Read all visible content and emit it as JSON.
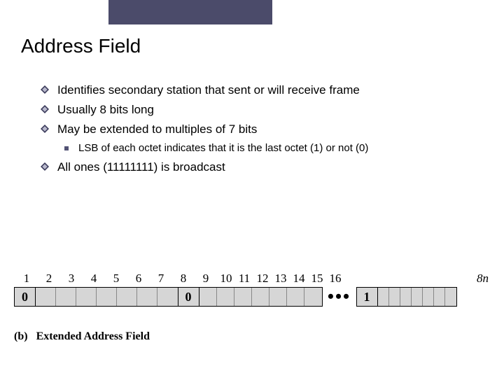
{
  "title": "Address Field",
  "bullets": {
    "b1": "Identifies secondary station that sent or will receive frame",
    "b2": "Usually 8 bits long",
    "b3": "May be extended to multiples of 7 bits",
    "b3_sub": "LSB of each octet indicates that it is the last octet (1) or not (0)",
    "b4": "All ones (11111111) is broadcast"
  },
  "diagram": {
    "numbers": [
      "1",
      "2",
      "3",
      "4",
      "5",
      "6",
      "7",
      "8",
      "9",
      "10",
      "11",
      "12",
      "13",
      "14",
      "15",
      "16"
    ],
    "end_label": "8n",
    "first_octet_bit0": "0",
    "second_octet_bit0": "0",
    "last_octet_bit0": "1",
    "dots": "•••"
  },
  "caption_prefix": "(b)",
  "caption_text": "Extended Address Field"
}
